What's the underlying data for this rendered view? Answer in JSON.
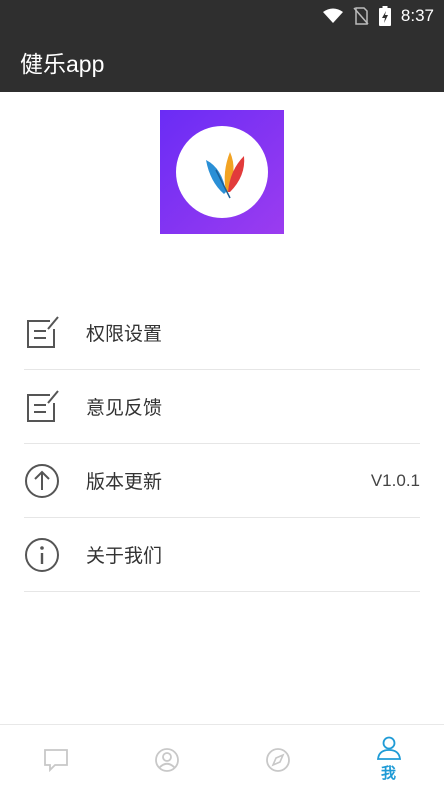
{
  "status_bar": {
    "time": "8:37"
  },
  "app_bar": {
    "title": "健乐app"
  },
  "menu": {
    "items": [
      {
        "label": "权限设置",
        "icon": "edit-note-icon"
      },
      {
        "label": "意见反馈",
        "icon": "edit-note-icon"
      },
      {
        "label": "版本更新",
        "icon": "arrow-up-circle-icon",
        "value": "V1.0.1"
      },
      {
        "label": "关于我们",
        "icon": "info-circle-icon"
      }
    ]
  },
  "bottom_nav": {
    "tabs": [
      {
        "icon": "message-icon",
        "label": ""
      },
      {
        "icon": "user-circle-icon",
        "label": ""
      },
      {
        "icon": "compass-icon",
        "label": ""
      },
      {
        "icon": "person-icon",
        "label": "我",
        "active": true
      }
    ]
  },
  "colors": {
    "header_bg": "#2f2f2f",
    "accent": "#1f9bd6",
    "logo_bg": "#7a30f2",
    "inactive_icon": "#c8c8c8"
  }
}
